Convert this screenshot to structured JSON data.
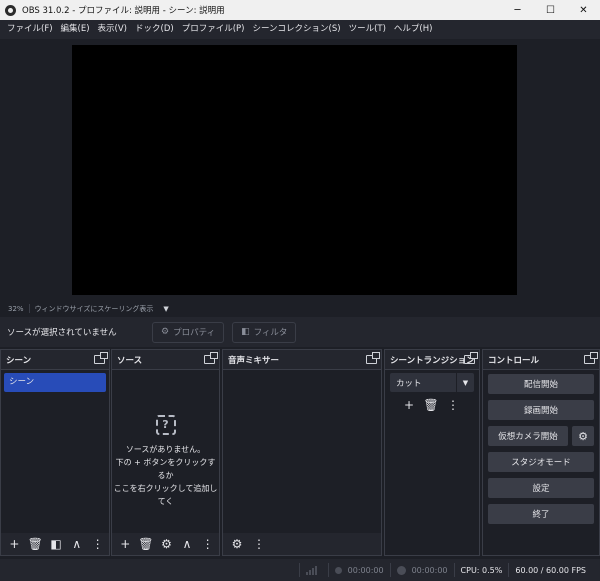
{
  "window": {
    "title": "OBS 31.0.2 - プロファイル: 説明用 - シーン: 説明用",
    "minimize": "─",
    "maximize": "☐",
    "close": "✕"
  },
  "menu": [
    "ファイル(F)",
    "編集(E)",
    "表示(V)",
    "ドック(D)",
    "プロファイル(P)",
    "シーンコレクション(S)",
    "ツール(T)",
    "ヘルプ(H)"
  ],
  "preview": {
    "zoom": "32%",
    "scaling": "ウィンドウサイズにスケーリング表示",
    "caret": "▼"
  },
  "source_bar": {
    "no_selection": "ソースが選択されていません",
    "properties": "プロパティ",
    "filters": "フィルタ",
    "properties_icon": "⚙",
    "filters_icon": "◧"
  },
  "docks": {
    "scenes": {
      "title": "シーン",
      "items": [
        "シーン"
      ]
    },
    "sources": {
      "title": "ソース",
      "empty_icon": "?",
      "empty_lines": [
        "ソースがありません。",
        "下の + ボタンをクリックするか",
        "ここを右クリックして追加してく"
      ]
    },
    "mixer": {
      "title": "音声ミキサー"
    },
    "transitions": {
      "title": "シーントランジション",
      "selected": "カット"
    },
    "controls": {
      "title": "コントロール",
      "stream": "配信開始",
      "record": "録画開始",
      "virtual_cam": "仮想カメラ開始",
      "studio_mode": "スタジオモード",
      "settings": "設定",
      "exit": "終了"
    }
  },
  "icons": {
    "add": "+",
    "remove": "🗑",
    "settings": "⚙",
    "up": "∧",
    "down": "∨",
    "more": "⋮",
    "filter": "◧"
  },
  "status": {
    "record_time": "00:00:00",
    "stream_time": "00:00:00",
    "cpu": "CPU: 0.5%",
    "fps": "60.00 / 60.00 FPS"
  },
  "colors": {
    "background": "#1d1f26",
    "panel": "#24262e",
    "accent": "#284cb8"
  }
}
